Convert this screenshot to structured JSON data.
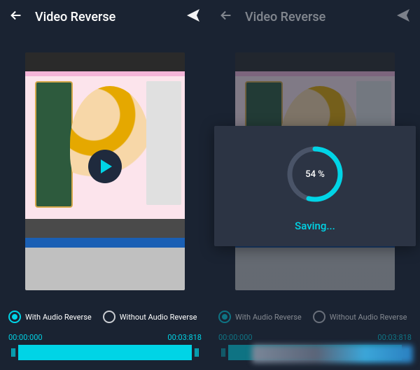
{
  "header": {
    "title": "Video Reverse"
  },
  "options": {
    "with_audio": "With Audio Reverse",
    "without_audio": "Without Audio  Reverse"
  },
  "timeline": {
    "start": "00:00:000",
    "end": "00:03:818"
  },
  "modal": {
    "percent": "54 %",
    "status": "Saving..."
  },
  "colors": {
    "accent": "#00d4e6",
    "bg": "#1a2332",
    "panel": "#2c3444"
  }
}
